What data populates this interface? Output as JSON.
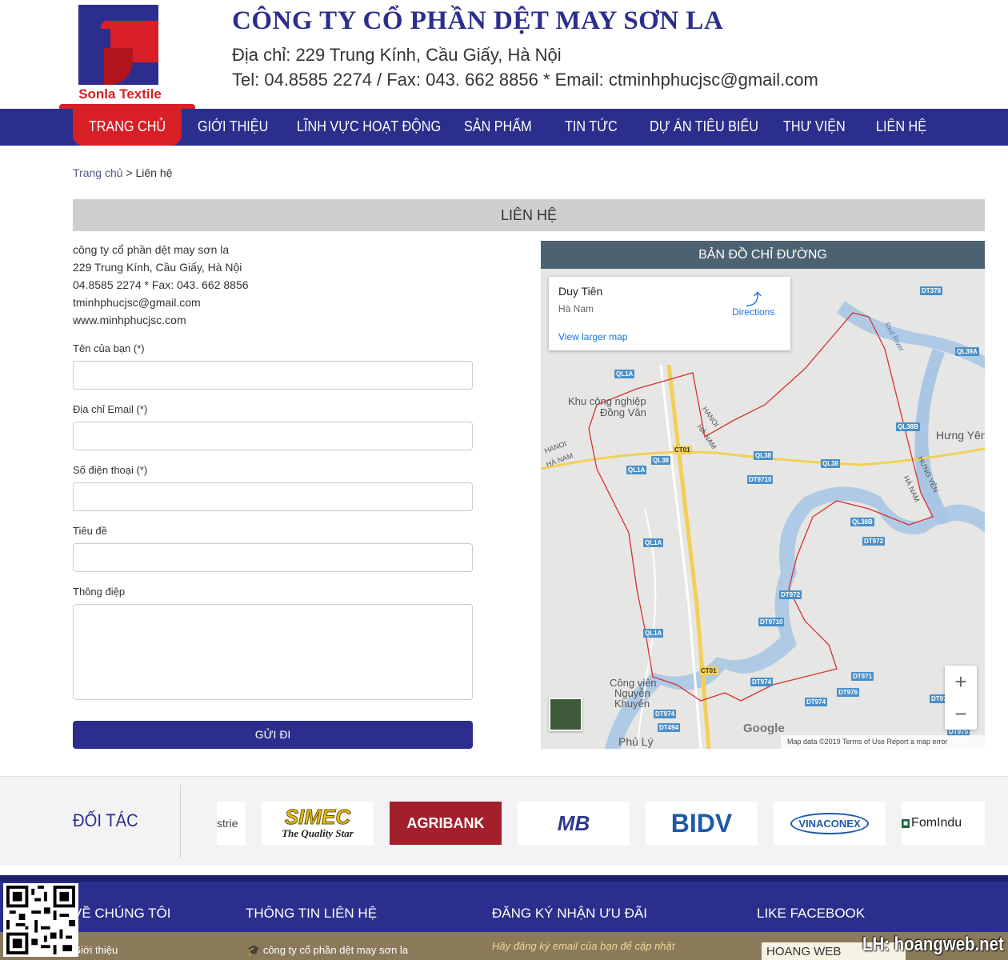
{
  "header": {
    "logo_text": "Sonla Textile",
    "company_name": "CÔNG TY CỔ PHẦN DỆT MAY SƠN LA",
    "address": "Địa chỉ: 229 Trung Kính, Cầu Giấy, Hà Nội",
    "contact": "Tel: 04.8585 2274 / Fax: 043. 662 8856 * Email: ctminhphucjsc@gmail.com"
  },
  "nav": {
    "items": [
      {
        "label": "TRANG CHỦ"
      },
      {
        "label": "GIỚI THIỆU"
      },
      {
        "label": "LĨNH VỰC HOẠT ĐỘNG"
      },
      {
        "label": "SẢN PHẨM"
      },
      {
        "label": "TIN TỨC"
      },
      {
        "label": "DỰ ÁN TIÊU BIỂU"
      },
      {
        "label": "THƯ VIỆN"
      },
      {
        "label": "LIÊN HỆ"
      }
    ]
  },
  "breadcrumb": {
    "home": "Trang chủ",
    "separator": " > ",
    "current": "Liên hệ"
  },
  "page_title": "LIÊN HỆ",
  "contact_info": {
    "company": "công ty cổ phần dệt may sơn la",
    "address": "229 Trung Kính, Cầu Giấy, Hà Nội",
    "phone": "04.8585 2274 * Fax: 043. 662 8856",
    "email": "tminhphucjsc@gmail.com",
    "website": "www.minhphucjsc.com"
  },
  "form": {
    "name_label": "Tên của bạn (*)",
    "email_label": "Địa chỉ Email (*)",
    "phone_label": "Số điện thoại (*)",
    "subject_label": "Tiêu đề",
    "message_label": "Thông điệp",
    "submit_label": "GỬI ĐI"
  },
  "map": {
    "title": "BẢN ĐỒ CHỈ ĐƯỜNG",
    "place": "Duy Tiên",
    "region": "Hà Nam",
    "directions": "Directions",
    "larger_map": "View larger map",
    "labels": {
      "kcn": "Khu công nghiệp",
      "dong_van": "Đồng Văn",
      "hung_yen": "Hưng Yên",
      "cong_vien": "Công viên",
      "nguyen": "Nguyễn",
      "khuyen": "Khuyến",
      "phu_ly": "Phủ Lý",
      "red_river": "Red River",
      "hanoi1": "HANOI",
      "hanam1": "HÀ NAM",
      "hanoi2": "HANOI",
      "hanam2": "HÀ NAM",
      "hungyen_v": "HƯNG YÊN",
      "hanam3": "HÀ NAM"
    },
    "roads": [
      "DT378",
      "QL39A",
      "QL1A",
      "QL38B",
      "CT01",
      "QL38",
      "QL1A",
      "DT9710",
      "QL38",
      "QL38",
      "QL38B",
      "DT972",
      "QL1A",
      "DT972",
      "DT9710",
      "QL1A",
      "CT01",
      "DT971",
      "DT974",
      "DT976",
      "DT974",
      "DT972",
      "DT974",
      "DT494",
      "DT975"
    ],
    "zoom_in": "+",
    "zoom_out": "−",
    "google": "Google",
    "footer": "Map data ©2019    Terms of Use    Report a map error"
  },
  "partners": {
    "title": "ĐỐI TÁC",
    "cut": "strie",
    "simec": "SIMEC",
    "simec_tag": "The Quality Star",
    "agribank": "AGRIBANK",
    "mb": "MB",
    "bidv": "BIDV",
    "vinaconex": "VINACONEX",
    "fomi": "FomIndu"
  },
  "footer": {
    "col1_title": "VỀ CHÚNG TÔI",
    "col1_link": "Giới thiệu",
    "col2_title": "THÔNG TIN LIÊN HỆ",
    "col2_link": "công ty cổ phần dệt may sơn la",
    "col3_title": "ĐĂNG KÝ NHẬN ƯU ĐÃI",
    "col3_text": "Hãy đăng ký email của bạn để cập nhật",
    "col4_title": "LIKE FACEBOOK",
    "fb_text": "HOANG WEB",
    "watermark": "LH: hoangweb.net"
  },
  "colors": {
    "primary": "#2b2e8c",
    "accent": "#d81f26",
    "footer_bottom": "#8a7a5a"
  }
}
